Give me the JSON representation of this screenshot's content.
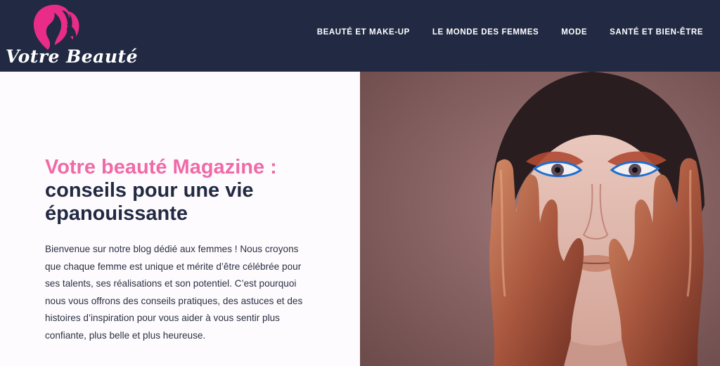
{
  "header": {
    "logo_text": "Votre Beauté",
    "nav": [
      "BEAUTÉ ET MAKE-UP",
      "LE MONDE DES FEMMES",
      "MODE",
      "SANTÉ ET BIEN-ÊTRE"
    ]
  },
  "hero": {
    "title_accent": "Votre beauté Magazine :",
    "title_main": "conseils pour une vie épanouissante",
    "intro": "Bienvenue sur notre blog dédié aux femmes ! Nous croyons que chaque femme est unique et mérite d’être célébrée pour ses talents, ses réalisations et son potentiel. C’est pourquoi nous vous offrons des conseils pratiques, des astuces et des histoires d’inspiration pour vous aider à vous sentir plus confiante, plus belle et plus heureuse."
  },
  "colors": {
    "header_bg": "#222a43",
    "accent_pink": "#f06aa8",
    "photo_bg": "#8a6462",
    "hand_copper": "#b0654a"
  }
}
